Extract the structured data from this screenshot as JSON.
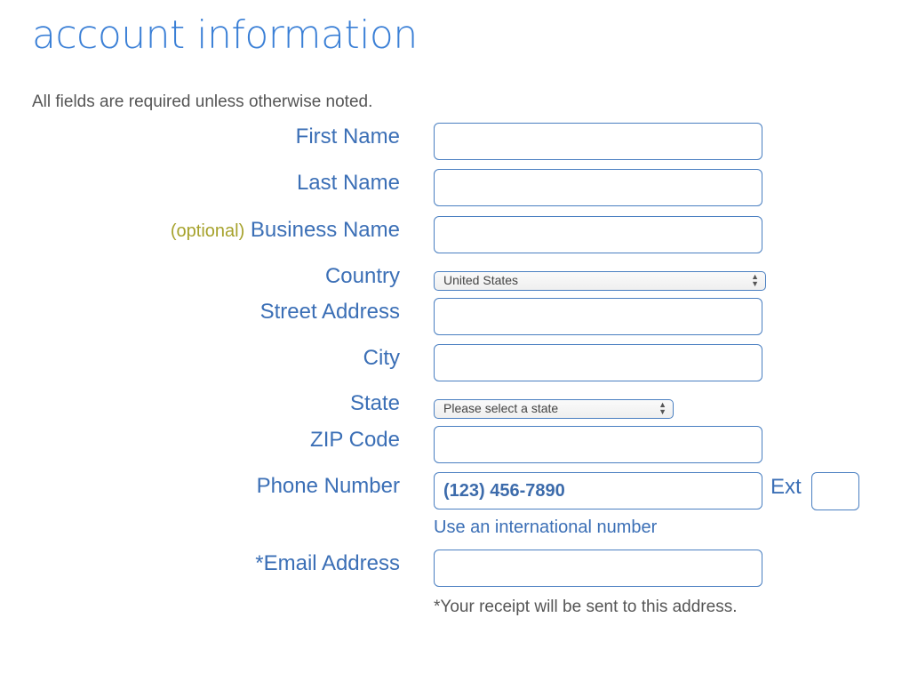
{
  "header": {
    "title": "account information",
    "note": "All fields are required unless otherwise noted."
  },
  "form": {
    "first_name": {
      "label": "First Name",
      "value": ""
    },
    "last_name": {
      "label": "Last Name",
      "value": ""
    },
    "business_name": {
      "optional_tag": "(optional)",
      "label": "Business Name",
      "value": ""
    },
    "country": {
      "label": "Country",
      "selected": "United States"
    },
    "street_address": {
      "label": "Street Address",
      "value": ""
    },
    "city": {
      "label": "City",
      "value": ""
    },
    "state": {
      "label": "State",
      "selected": "Please select a state"
    },
    "zip": {
      "label": "ZIP Code",
      "value": ""
    },
    "phone": {
      "label": "Phone Number",
      "placeholder": "(123) 456-7890",
      "help_link": "Use an international number"
    },
    "ext": {
      "label": "Ext",
      "value": ""
    },
    "email": {
      "label": "*Email Address",
      "value": "",
      "note": "*Your receipt will be sent to this address."
    }
  }
}
